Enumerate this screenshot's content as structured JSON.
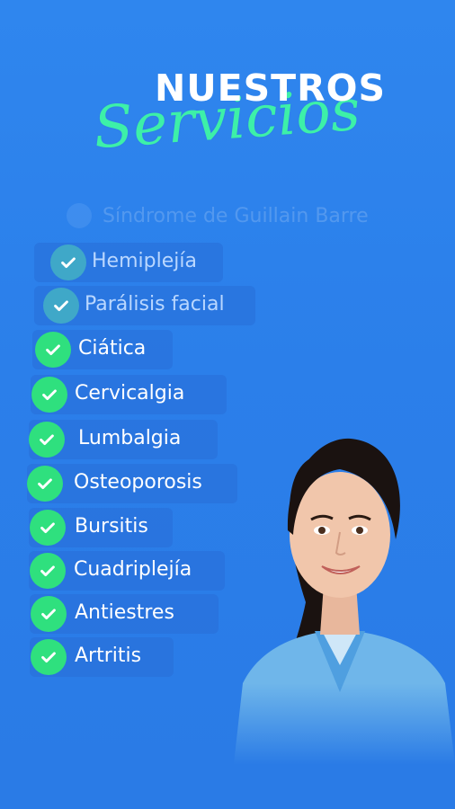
{
  "title": {
    "main": "NUESTROS",
    "script": "Servicios"
  },
  "faded_item": "Síndrome de Guillain Barre",
  "services": [
    "Hemiplejía",
    "Parálisis facial",
    "Ciática",
    "Cervicalgia",
    "Lumbalgia",
    "Osteoporosis",
    "Bursitis",
    "Cuadriplejía",
    "Antiestres",
    "Artritis"
  ],
  "colors": {
    "background": "#2b7fea",
    "accent_green": "#2fe07e",
    "script_green": "#3df0a8",
    "scrub_blue": "#6fb6ea"
  },
  "icons": {
    "check": "check-circle-icon",
    "photo": "nurse-photo"
  }
}
